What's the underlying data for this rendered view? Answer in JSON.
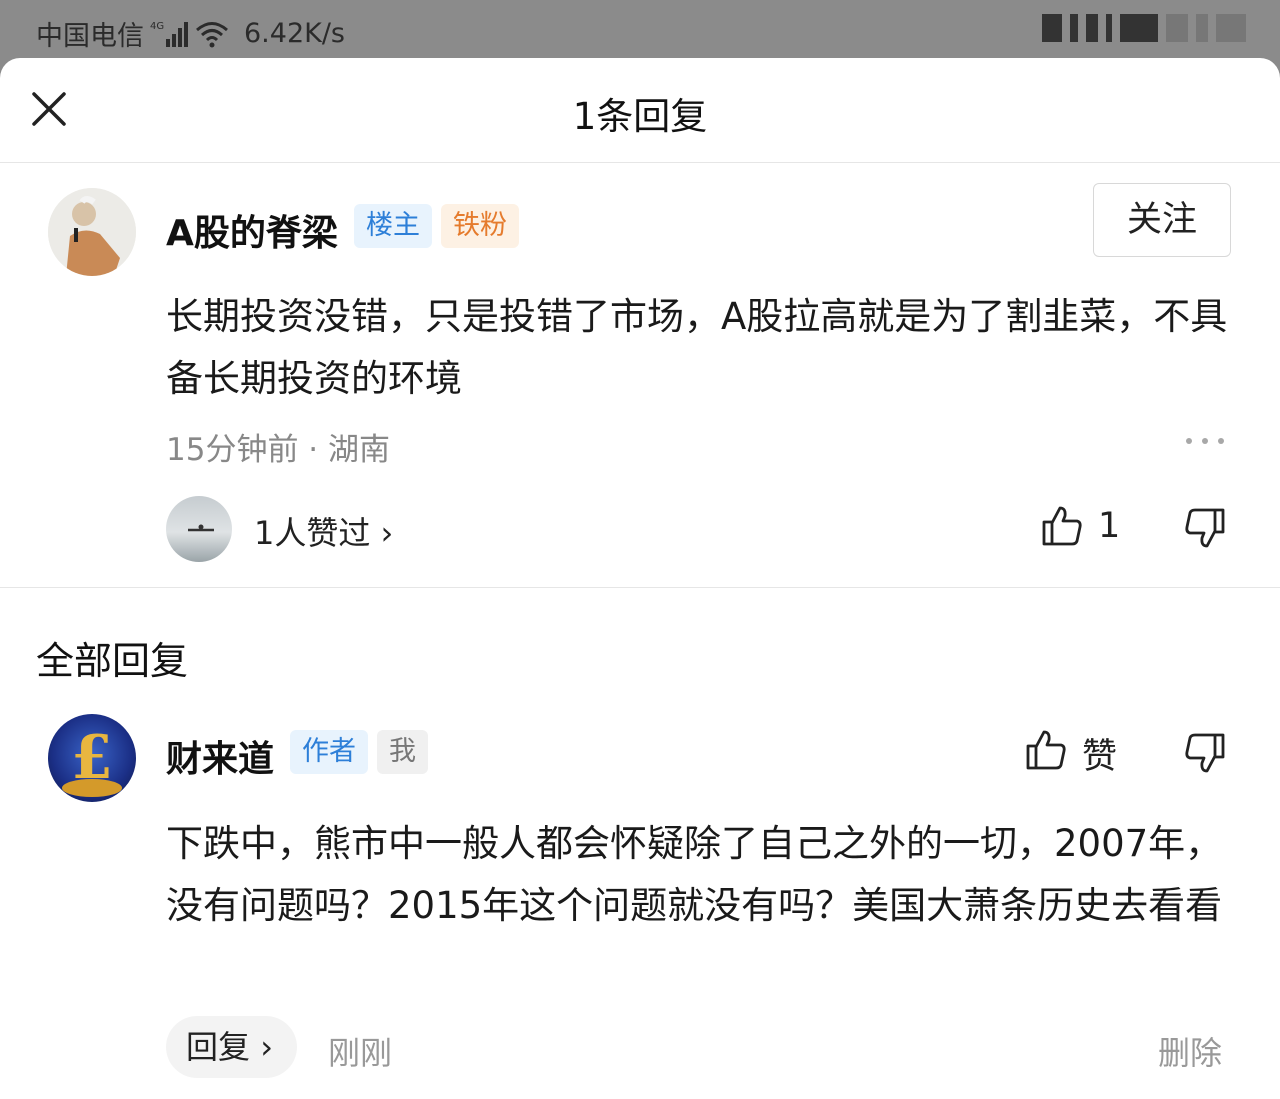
{
  "status_bar": {
    "carrier": "中国电信",
    "net_type": "4G",
    "speed": "6.42K/s"
  },
  "header": {
    "title": "1条回复"
  },
  "main_comment": {
    "author": "A股的脊梁",
    "badges": [
      "楼主",
      "铁粉"
    ],
    "follow_label": "关注",
    "text": "长期投资没错，只是投错了市场，A股拉高就是为了割韭菜，不具备长期投资的环境",
    "meta": "15分钟前 · 湖南",
    "likers_text": "1人赞过",
    "like_count": "1"
  },
  "replies_section": {
    "title": "全部回复"
  },
  "reply": {
    "author": "财来道",
    "badges": [
      "作者",
      "我"
    ],
    "like_label": "赞",
    "text": "下跌中，熊市中一般人都会怀疑除了自己之外的一切，2007年，没有问题吗？2015年这个问题就没有吗？美国大萧条历史去看看",
    "reply_label": "回复",
    "time": "刚刚",
    "delete_label": "删除"
  },
  "colors": {
    "badge_blue": "#2d7fd8",
    "badge_orange": "#e57b2d",
    "muted": "#999999"
  }
}
